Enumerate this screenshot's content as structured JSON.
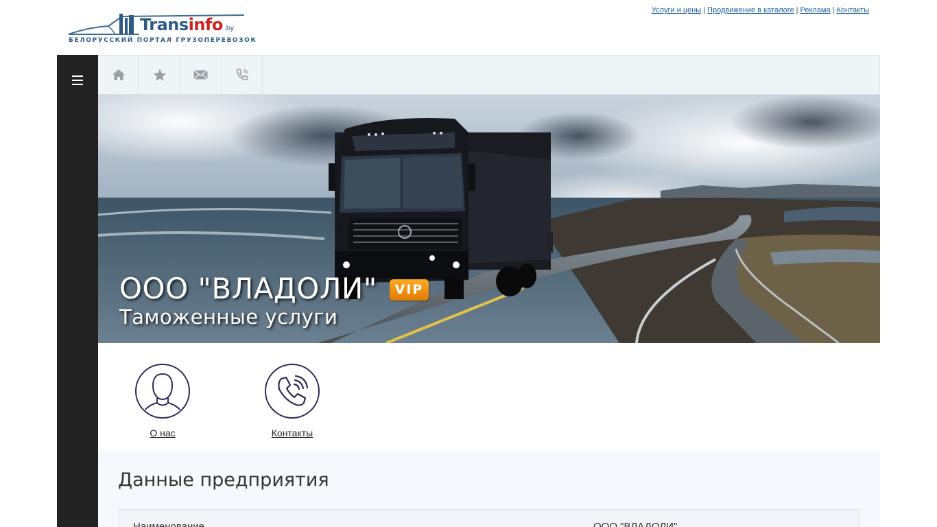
{
  "header": {
    "logo": {
      "word_main": "Trans",
      "word_accent": "info",
      "tld": ".by",
      "slogan": "БЕЛОРУССКИЙ ПОРТАЛ ГРУЗОПЕРЕВОЗОК"
    },
    "links": [
      {
        "label": "Услуги и цены"
      },
      {
        "label": "Продвижение в каталоге"
      },
      {
        "label": "Реклама"
      },
      {
        "label": "Контакты"
      }
    ],
    "separator": "|"
  },
  "sidebar": {
    "menu_icon": "hamburger-menu-icon"
  },
  "toolbar": {
    "items": [
      {
        "icon": "home-icon"
      },
      {
        "icon": "star-icon"
      },
      {
        "icon": "mail-icon"
      },
      {
        "icon": "phone-icon"
      }
    ]
  },
  "hero": {
    "title": "ООО \"ВЛАДОЛИ\"",
    "badge": "VIP",
    "subtitle": "Таможенные услуги"
  },
  "quick_links": [
    {
      "label": "О нас",
      "icon": "person-icon"
    },
    {
      "label": "Контакты",
      "icon": "phone-ringing-icon"
    }
  ],
  "company_data": {
    "title": "Данные предприятия",
    "rows": [
      {
        "key": "Наименование",
        "value": "ООО \"ВЛАДОЛИ\""
      }
    ]
  },
  "colors": {
    "sidebar": "#222222",
    "toolbar": "#eff4f7",
    "link": "#1a5d99",
    "badge": "#f08c00",
    "circle_stroke": "#2a2a5a"
  }
}
